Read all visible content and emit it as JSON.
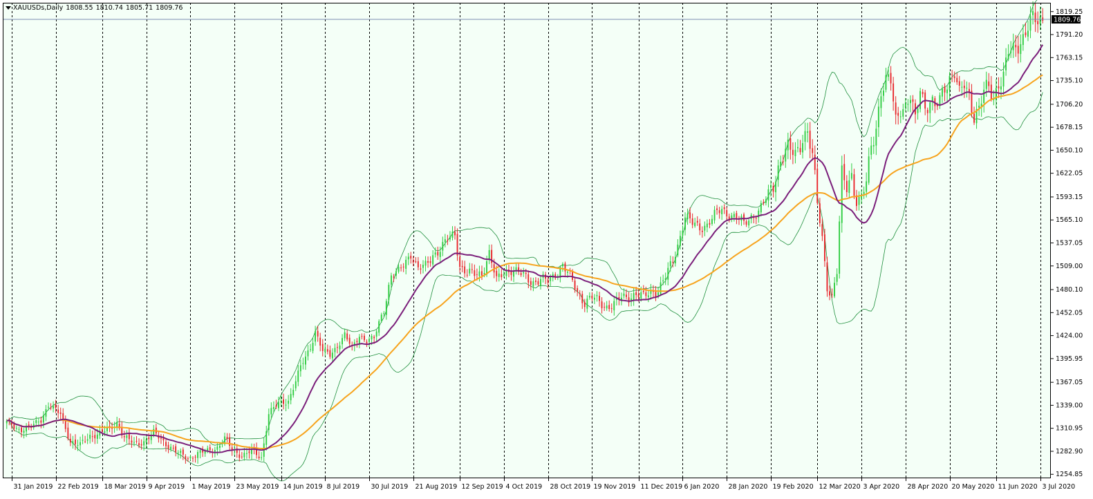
{
  "header": {
    "symbol_timeframe": "XAUUSDs,Daily",
    "open": "1808.55",
    "high": "1810.74",
    "low": "1805.71",
    "close": "1809.76"
  },
  "colors": {
    "background": "#F4FFF7",
    "bull": "#2ECC40",
    "bear": "#E8262B",
    "ma_fast": "#7A1E7A",
    "ma_slow": "#F7A31C",
    "bollinger": "#1E8F3C",
    "grid": "#000000",
    "price_line": "#7A8CB0"
  },
  "chart_data": {
    "type": "candlestick",
    "symbol": "XAUUSDs",
    "timeframe": "Daily",
    "current_price_label": "1809.76",
    "ylim": [
      1250,
      1830
    ],
    "y_ticks": [
      "1819.25",
      "1791.20",
      "1763.15",
      "1735.10",
      "1706.20",
      "1678.15",
      "1650.10",
      "1622.05",
      "1593.15",
      "1565.10",
      "1537.05",
      "1509.00",
      "1480.10",
      "1452.05",
      "1424.00",
      "1395.95",
      "1367.05",
      "1339.00",
      "1310.95",
      "1282.90",
      "1254.85"
    ],
    "x_ticks": [
      "31 Jan 2019",
      "22 Feb 2019",
      "18 Mar 2019",
      "9 Apr 2019",
      "1 May 2019",
      "23 May 2019",
      "14 Jun 2019",
      "8 Jul 2019",
      "30 Jul 2019",
      "21 Aug 2019",
      "12 Sep 2019",
      "4 Oct 2019",
      "28 Oct 2019",
      "19 Nov 2019",
      "11 Dec 2019",
      "6 Jan 2020",
      "28 Jan 2020",
      "19 Feb 2020",
      "12 Mar 2020",
      "3 Apr 2020",
      "28 Apr 2020",
      "20 May 2020",
      "11 Jun 2020",
      "3 Jul 2020"
    ],
    "close_anchors": [
      [
        0,
        1318
      ],
      [
        5,
        1310
      ],
      [
        10,
        1312
      ],
      [
        14,
        1322
      ],
      [
        17,
        1340
      ],
      [
        20,
        1332
      ],
      [
        22,
        1328
      ],
      [
        26,
        1295
      ],
      [
        30,
        1290
      ],
      [
        34,
        1302
      ],
      [
        38,
        1305
      ],
      [
        42,
        1310
      ],
      [
        45,
        1318
      ],
      [
        48,
        1300
      ],
      [
        52,
        1292
      ],
      [
        56,
        1295
      ],
      [
        60,
        1305
      ],
      [
        63,
        1298
      ],
      [
        66,
        1290
      ],
      [
        70,
        1280
      ],
      [
        74,
        1275
      ],
      [
        78,
        1280
      ],
      [
        82,
        1283
      ],
      [
        86,
        1288
      ],
      [
        89,
        1298
      ],
      [
        92,
        1285
      ],
      [
        96,
        1278
      ],
      [
        100,
        1283
      ],
      [
        104,
        1275
      ],
      [
        107,
        1330
      ],
      [
        111,
        1340
      ],
      [
        115,
        1345
      ],
      [
        120,
        1385
      ],
      [
        124,
        1410
      ],
      [
        126,
        1430
      ],
      [
        129,
        1405
      ],
      [
        132,
        1400
      ],
      [
        135,
        1412
      ],
      [
        138,
        1425
      ],
      [
        141,
        1408
      ],
      [
        144,
        1425
      ],
      [
        147,
        1418
      ],
      [
        150,
        1420
      ],
      [
        154,
        1458
      ],
      [
        157,
        1498
      ],
      [
        160,
        1500
      ],
      [
        163,
        1515
      ],
      [
        165,
        1525
      ],
      [
        168,
        1505
      ],
      [
        171,
        1508
      ],
      [
        174,
        1523
      ],
      [
        177,
        1530
      ],
      [
        180,
        1540
      ],
      [
        183,
        1548
      ],
      [
        185,
        1510
      ],
      [
        188,
        1500
      ],
      [
        191,
        1498
      ],
      [
        194,
        1500
      ],
      [
        197,
        1525
      ],
      [
        200,
        1490
      ],
      [
        203,
        1502
      ],
      [
        206,
        1505
      ],
      [
        209,
        1500
      ],
      [
        212,
        1495
      ],
      [
        215,
        1490
      ],
      [
        218,
        1492
      ],
      [
        221,
        1490
      ],
      [
        224,
        1500
      ],
      [
        227,
        1510
      ],
      [
        230,
        1495
      ],
      [
        233,
        1478
      ],
      [
        236,
        1465
      ],
      [
        239,
        1470
      ],
      [
        242,
        1465
      ],
      [
        245,
        1460
      ],
      [
        248,
        1462
      ],
      [
        251,
        1470
      ],
      [
        254,
        1472
      ],
      [
        257,
        1475
      ],
      [
        260,
        1470
      ],
      [
        263,
        1478
      ],
      [
        266,
        1480
      ],
      [
        269,
        1495
      ],
      [
        272,
        1515
      ],
      [
        274,
        1535
      ],
      [
        277,
        1570
      ],
      [
        280,
        1560
      ],
      [
        283,
        1556
      ],
      [
        286,
        1560
      ],
      [
        289,
        1570
      ],
      [
        292,
        1578
      ],
      [
        295,
        1572
      ],
      [
        298,
        1568
      ],
      [
        301,
        1560
      ],
      [
        304,
        1570
      ],
      [
        307,
        1575
      ],
      [
        310,
        1590
      ],
      [
        313,
        1610
      ],
      [
        316,
        1640
      ],
      [
        319,
        1650
      ],
      [
        322,
        1645
      ],
      [
        325,
        1668
      ],
      [
        327,
        1672
      ],
      [
        329,
        1640
      ],
      [
        331,
        1585
      ],
      [
        333,
        1545
      ],
      [
        335,
        1485
      ],
      [
        337,
        1470
      ],
      [
        339,
        1500
      ],
      [
        341,
        1620
      ],
      [
        343,
        1610
      ],
      [
        345,
        1622
      ],
      [
        347,
        1585
      ],
      [
        349,
        1590
      ],
      [
        351,
        1610
      ],
      [
        353,
        1660
      ],
      [
        355,
        1680
      ],
      [
        357,
        1720
      ],
      [
        359,
        1730
      ],
      [
        361,
        1735
      ],
      [
        363,
        1690
      ],
      [
        365,
        1705
      ],
      [
        367,
        1700
      ],
      [
        369,
        1712
      ],
      [
        371,
        1685
      ],
      [
        373,
        1730
      ],
      [
        375,
        1705
      ],
      [
        377,
        1708
      ],
      [
        379,
        1700
      ],
      [
        381,
        1710
      ],
      [
        383,
        1730
      ],
      [
        385,
        1740
      ],
      [
        387,
        1745
      ],
      [
        389,
        1715
      ],
      [
        391,
        1730
      ],
      [
        393,
        1718
      ],
      [
        395,
        1695
      ],
      [
        397,
        1700
      ],
      [
        399,
        1720
      ],
      [
        401,
        1725
      ],
      [
        403,
        1715
      ],
      [
        405,
        1735
      ],
      [
        407,
        1740
      ],
      [
        409,
        1768
      ],
      [
        411,
        1770
      ],
      [
        413,
        1780
      ],
      [
        415,
        1790
      ],
      [
        417,
        1802
      ],
      [
        419,
        1808
      ],
      [
        421,
        1805
      ],
      [
        423,
        1810
      ]
    ]
  }
}
